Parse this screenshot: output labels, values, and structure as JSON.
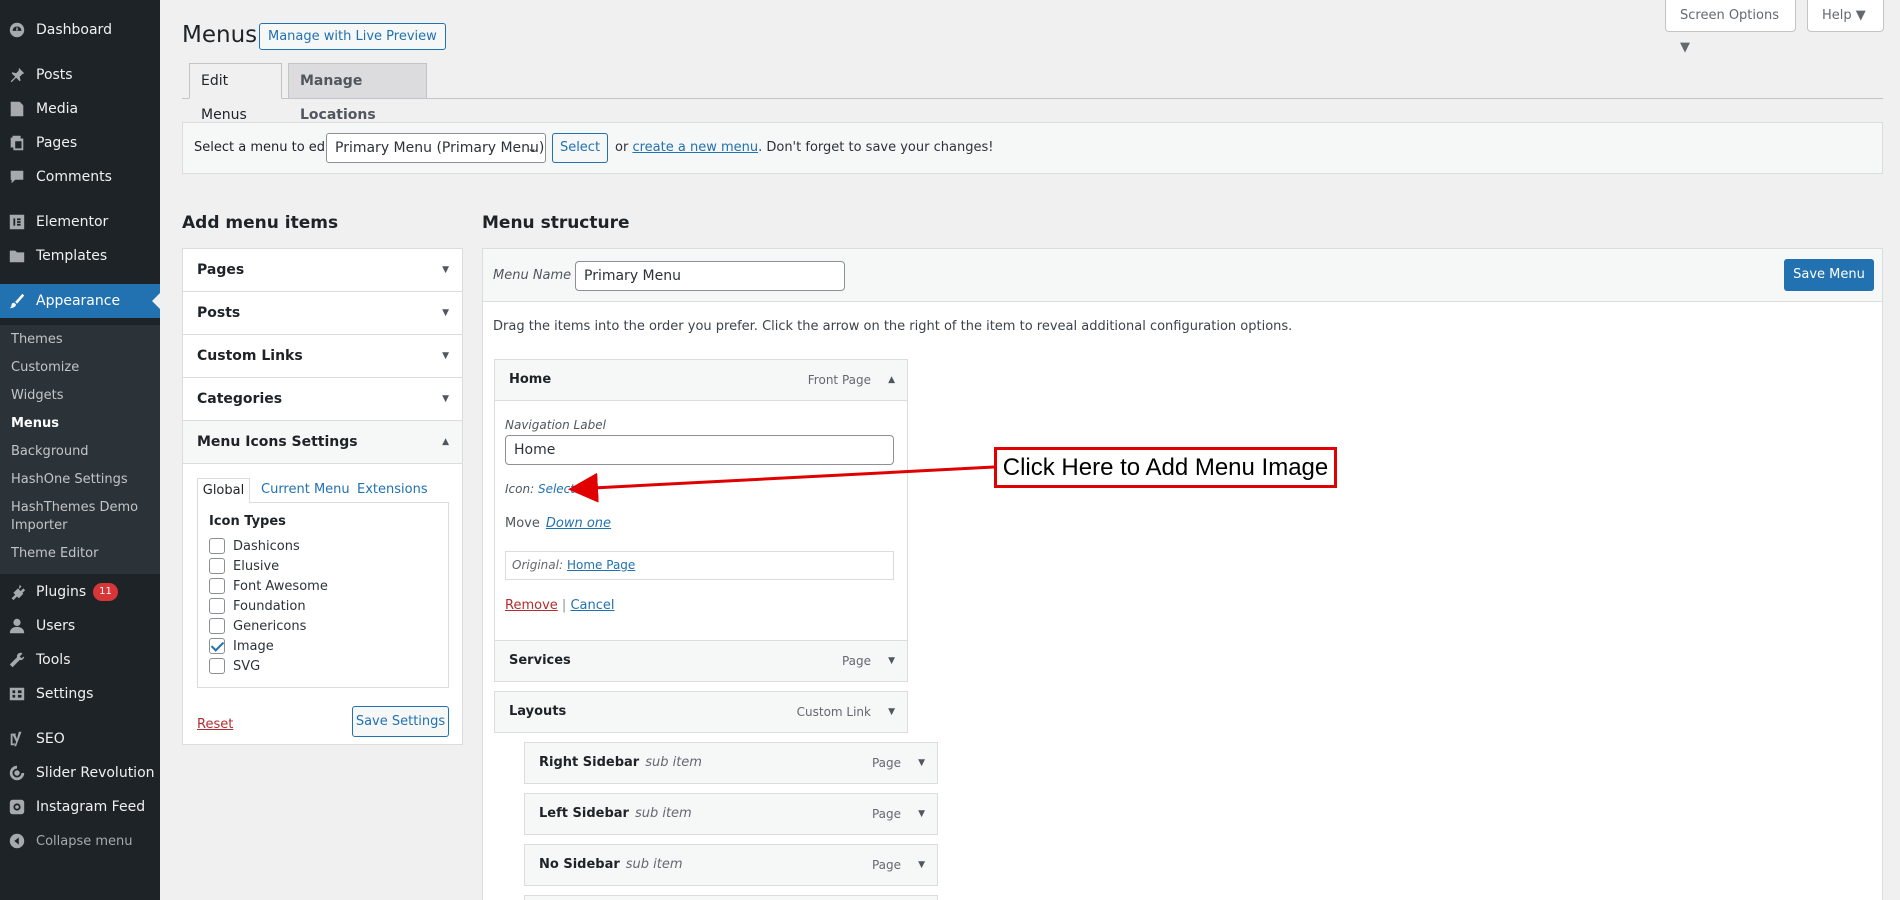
{
  "sidebar": {
    "items": [
      {
        "label": "Dashboard",
        "icon": "dashboard-icon"
      },
      {
        "label": "Posts",
        "icon": "pin-icon"
      },
      {
        "label": "Media",
        "icon": "media-icon"
      },
      {
        "label": "Pages",
        "icon": "pages-icon"
      },
      {
        "label": "Comments",
        "icon": "comment-icon"
      },
      {
        "label": "Elementor",
        "icon": "elementor-icon"
      },
      {
        "label": "Templates",
        "icon": "folder-icon"
      },
      {
        "label": "Appearance",
        "icon": "brush-icon"
      },
      {
        "label": "Plugins",
        "icon": "plugin-icon",
        "badge": "11"
      },
      {
        "label": "Users",
        "icon": "user-icon"
      },
      {
        "label": "Tools",
        "icon": "wrench-icon"
      },
      {
        "label": "Settings",
        "icon": "settings-icon"
      },
      {
        "label": "SEO",
        "icon": "yoast-icon"
      },
      {
        "label": "Slider Revolution",
        "icon": "revolution-icon"
      },
      {
        "label": "Instagram Feed",
        "icon": "instagram-icon"
      }
    ],
    "submenu": [
      "Themes",
      "Customize",
      "Widgets",
      "Menus",
      "Background",
      "HashOne Settings",
      "HashThemes Demo Importer",
      "Theme Editor"
    ],
    "collapse_label": "Collapse menu"
  },
  "header": {
    "title": "Menus",
    "live_preview": "Manage with Live Preview",
    "screen_options": "Screen Options ▼",
    "help": "Help ▼",
    "tabs": [
      "Edit Menus",
      "Manage Locations"
    ]
  },
  "select_bar": {
    "label": "Select a menu to edit:",
    "selected": "Primary Menu (Primary Menu)",
    "button": "Select",
    "or": "or",
    "create_link": "create a new menu",
    "note": ". Don't forget to save your changes!"
  },
  "add_items": {
    "heading": "Add menu items",
    "sections": [
      "Pages",
      "Posts",
      "Custom Links",
      "Categories",
      "Menu Icons Settings"
    ],
    "tabs": [
      "Global",
      "Current Menu",
      "Extensions"
    ],
    "icon_types_heading": "Icon Types",
    "icon_types": [
      {
        "label": "Dashicons",
        "checked": false
      },
      {
        "label": "Elusive",
        "checked": false
      },
      {
        "label": "Font Awesome",
        "checked": false
      },
      {
        "label": "Foundation",
        "checked": false
      },
      {
        "label": "Genericons",
        "checked": false
      },
      {
        "label": "Image",
        "checked": true
      },
      {
        "label": "SVG",
        "checked": false
      }
    ],
    "reset": "Reset",
    "save_settings": "Save Settings"
  },
  "structure": {
    "heading": "Menu structure",
    "menu_name_label": "Menu Name",
    "menu_name": "Primary Menu",
    "save_menu": "Save Menu",
    "help_text": "Drag the items into the order you prefer. Click the arrow on the right of the item to reveal additional configuration options.",
    "home": {
      "title": "Home",
      "type": "Front Page",
      "nav_label_label": "Navigation Label",
      "nav_label_value": "Home",
      "icon_label": "Icon:",
      "icon_select": "Select",
      "move_label": "Move",
      "move_link": "Down one",
      "original_label": "Original:",
      "original_link": "Home Page",
      "remove": "Remove",
      "separator": "|",
      "cancel": "Cancel"
    },
    "items": [
      {
        "title": "Services",
        "sub": "",
        "type": "Page"
      },
      {
        "title": "Layouts",
        "sub": "",
        "type": "Custom Link"
      },
      {
        "title": "Right Sidebar",
        "sub": "sub item",
        "type": "Page"
      },
      {
        "title": "Left Sidebar",
        "sub": "sub item",
        "type": "Page"
      },
      {
        "title": "No Sidebar",
        "sub": "sub item",
        "type": "Page"
      }
    ]
  },
  "callout": {
    "text": "Click Here to Add Menu Image",
    "color": "#e00000"
  },
  "colors": {
    "sidebar_bg": "#1d2327",
    "accent": "#2271b1",
    "badge": "#d63638"
  }
}
